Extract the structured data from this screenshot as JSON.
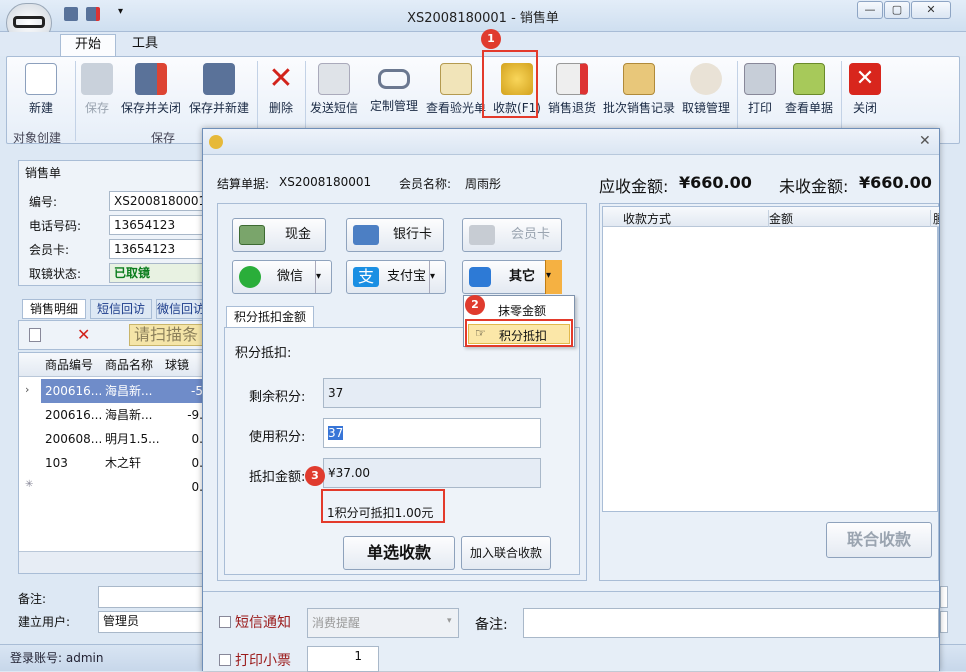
{
  "window": {
    "title": "XS2008180001 - 销售单",
    "min": "▭",
    "max": "▢",
    "close": "✕"
  },
  "tabs": [
    "开始",
    "工具"
  ],
  "ribbon": {
    "buttons": [
      "新建",
      "保存",
      "保存并关闭",
      "保存并新建",
      "删除",
      "发送短信",
      "定制管理",
      "查看验光单",
      "收款(F1)",
      "销售退货",
      "批次销售记录",
      "取镜管理",
      "打印",
      "查看单据",
      "关闭"
    ],
    "groups": [
      "对象创建",
      "保存"
    ]
  },
  "form": {
    "section": "销售单",
    "labels": [
      "编号:",
      "电话号码:",
      "会员卡:",
      "取镜状态:"
    ],
    "values": [
      "XS2008180001",
      "13654123",
      "13654123",
      "已取镜"
    ]
  },
  "subtabs": [
    "销售明细",
    "短信回访",
    "微信回访"
  ],
  "scan_placeholder": "请扫描条",
  "grid": {
    "headers": [
      "商品编号",
      "商品名称",
      "球镜"
    ],
    "rows": [
      [
        "200616...",
        "海昌新...",
        "-5"
      ],
      [
        "200616...",
        "海昌新...",
        "-9."
      ],
      [
        "200608...",
        "明月1.5...",
        "0."
      ],
      [
        "103",
        "木之轩",
        "0."
      ],
      [
        "",
        "",
        "0."
      ]
    ]
  },
  "footer": {
    "remark_label": "备注:",
    "user_label": "建立用户:",
    "user_value": "管理员",
    "status": "登录账号: admin"
  },
  "dialog": {
    "bill_label": "结算单据:",
    "bill_value": "XS2008180001",
    "member_label": "会员名称:",
    "member_value": "周雨彤",
    "due_label": "应收金额:",
    "due_value": "¥660.00",
    "unpaid_label": "未收金额:",
    "unpaid_value": "¥660.00",
    "pay": {
      "cash": "现金",
      "bank": "银行卡",
      "member": "会员卡",
      "wechat": "微信",
      "alipay": "支付宝",
      "other": "其它"
    },
    "menu": [
      "抹零金额",
      "积分抵扣"
    ],
    "points_tab": "积分抵扣金额",
    "points_title": "积分抵扣:",
    "remain_label": "剩余积分:",
    "remain_value": "37",
    "use_label": "使用积分:",
    "use_value": "37",
    "amount_label": "抵扣金额:",
    "amount_value": "¥37.00",
    "rule": "1积分可抵扣1.00元",
    "single_btn": "单选收款",
    "add_btn": "加入联合收款",
    "grid_headers": [
      "收款方式",
      "金额",
      "腫"
    ],
    "union_btn": "联合收款",
    "sms_label": "短信通知",
    "sms_select": "消费提醒",
    "remark_label": "备注:",
    "print_label": "打印小票",
    "print_count": "1"
  },
  "badges": [
    "1",
    "2",
    "3"
  ],
  "colors": {
    "accent": "#e33a2b",
    "selected_row": "#6f8cc9",
    "status_green": "#0a7d1c"
  }
}
